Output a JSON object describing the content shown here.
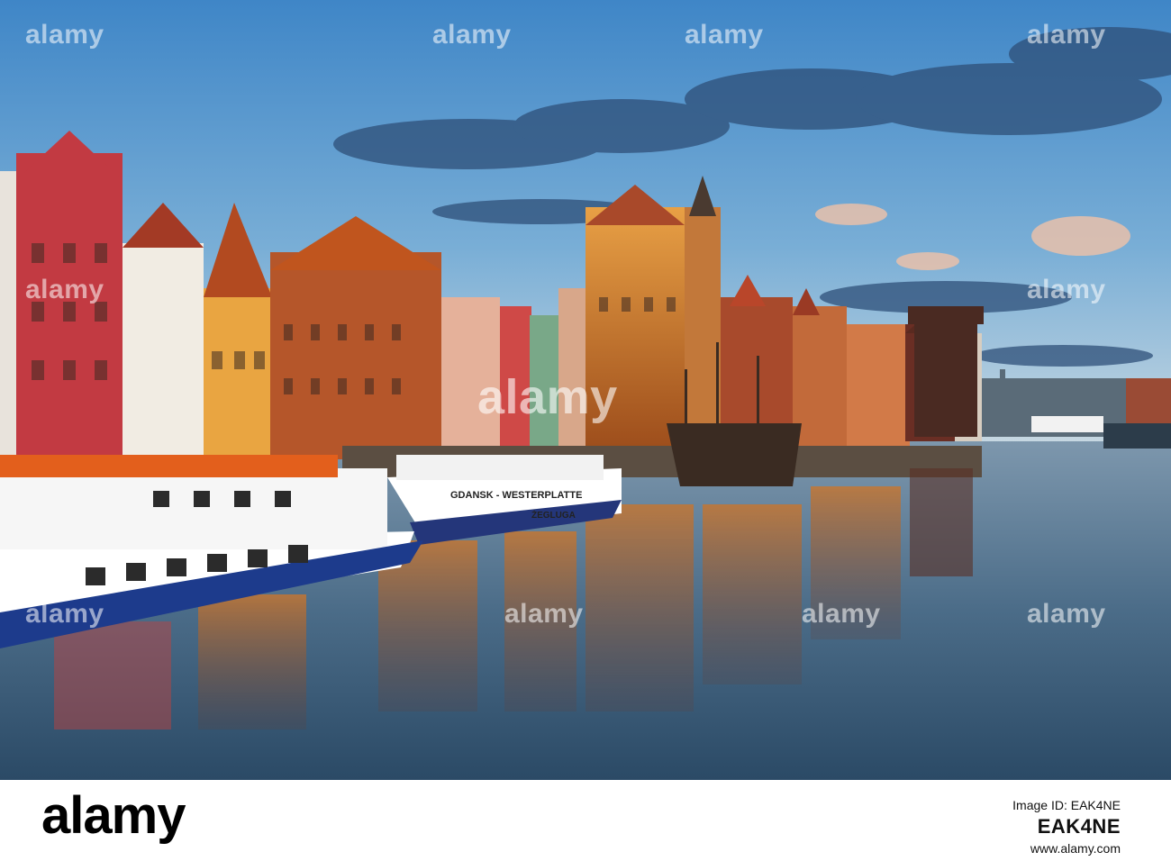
{
  "photo": {
    "alt_subject": "Gdansk waterfront",
    "boat_labels": {
      "left_stripe": "",
      "right_hull": "GDANSK - WESTERPLATTE",
      "right_name": "ŻEGLUGA"
    }
  },
  "watermark": {
    "text": "alamy"
  },
  "footer": {
    "brand": "alamy",
    "caption": "Image ID: EAK4NE",
    "url": "www.alamy.com",
    "image_id": "EAK4NE"
  },
  "colors": {
    "sky_top": "#3f86c7",
    "sky_bottom": "#b9d2e2",
    "water": "#4f6f8a",
    "brick": "#b5562a",
    "red_facade": "#c23a42"
  }
}
